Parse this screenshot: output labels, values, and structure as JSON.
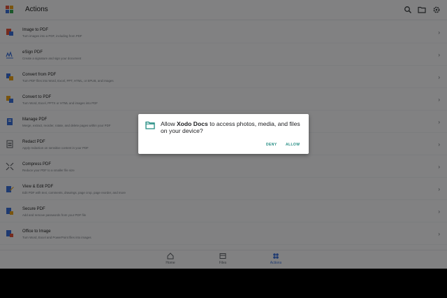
{
  "app": {
    "title": "Actions"
  },
  "header_icons": [
    "search-icon",
    "folder-icon",
    "gear-icon"
  ],
  "actions": [
    {
      "title": "Image to PDF",
      "desc": "Turn images into a PDF, including from PDF",
      "icon": "image-pdf-icon",
      "color": "#e2533b"
    },
    {
      "title": "eSign PDF",
      "desc": "Create a signature and sign your document",
      "icon": "signature-icon",
      "color": "#3b6fd8"
    },
    {
      "title": "Convert from PDF",
      "desc": "Turn PDF files into Word, Excel, PPT, HTML, or EPUB, and images",
      "icon": "convert-from-pdf-icon",
      "color": "#e9a21b"
    },
    {
      "title": "Convert to PDF",
      "desc": "Turn Word, Excel, PPTX or HTML and images into PDF",
      "icon": "convert-to-pdf-icon",
      "color": "#e9a21b"
    },
    {
      "title": "Manage PDF",
      "desc": "Merge, extract, reorder, rotate, and delete pages within your PDF",
      "icon": "manage-pdf-icon",
      "color": "#3b6fd8"
    },
    {
      "title": "Redact PDF",
      "desc": "Apply redaction on sensitive content in your PDF",
      "icon": "redact-icon",
      "color": "#5f6368"
    },
    {
      "title": "Compress PDF",
      "desc": "Reduce your PDF to a smaller file size",
      "icon": "compress-icon",
      "color": "#5f6368"
    },
    {
      "title": "View & Edit PDF",
      "desc": "Edit PDF with text, comments, drawings, page crop, page reorder, and more",
      "icon": "view-edit-icon",
      "color": "#3b6fd8"
    },
    {
      "title": "Secure PDF",
      "desc": "Add and remove passwords from your PDF file",
      "icon": "secure-pdf-icon",
      "color": "#3b6fd8"
    },
    {
      "title": "Office to Image",
      "desc": "Turn Word, Excel and PowerPoint files into images",
      "icon": "office-image-icon",
      "color": "#3b6fd8"
    }
  ],
  "bottom_nav": [
    {
      "label": "Home",
      "icon": "home-icon",
      "active": false
    },
    {
      "label": "Files",
      "icon": "files-icon",
      "active": false
    },
    {
      "label": "Actions",
      "icon": "actions-icon",
      "active": true
    }
  ],
  "dialog": {
    "text_before": "Allow ",
    "app_name": "Xodo Docs",
    "text_after": " to access photos, media, and files on your device?",
    "deny_label": "DENY",
    "allow_label": "ALLOW",
    "icon": "folder-icon",
    "accent": "#1f8a80"
  },
  "colors": {
    "accent": "#3b6fd8",
    "dialog_accent": "#1f8a80"
  }
}
